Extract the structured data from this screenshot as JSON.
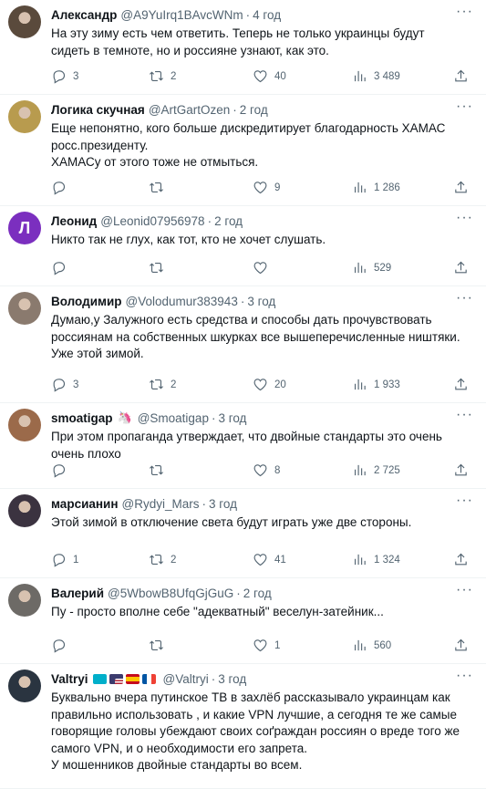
{
  "tweets": [
    {
      "name": "Александр",
      "handle": "@A9YuIrq1BAvcWNm",
      "time": "4 год",
      "text": "На эту зиму есть чем ответить. Теперь не только украинцы будут\nсидеть в темноте, но и россияне узнают, как это.",
      "replies": "3",
      "retweets": "2",
      "likes": "40",
      "views": "3 489",
      "avatar_color": "#5a4a3c",
      "avatar_letter": ""
    },
    {
      "name": "Логика скучная",
      "handle": "@ArtGartOzen",
      "time": "2 год",
      "text": "Еще непонятно, кого больше дискредитирует благодарность ХАМАС\nросс.президенту.\nХАМАСу от этого тоже не отмыться.",
      "replies": "",
      "retweets": "",
      "likes": "9",
      "views": "1 286",
      "avatar_color": "#b89b4e",
      "avatar_letter": ""
    },
    {
      "name": "Леонид",
      "handle": "@Leonid07956978",
      "time": "2 год",
      "text": "Никто так не глух, как тот, кто не хочет слушать.",
      "replies": "",
      "retweets": "",
      "likes": "",
      "views": "529",
      "avatar_color": "#7b2fbf",
      "avatar_letter": "Л"
    },
    {
      "name": "Володимир",
      "handle": "@Volodumur383943",
      "time": "3 год",
      "text": "Думаю,у Залужного есть средства и способы дать прочувствовать\nроссиянам на собственных шкурках все вышеперечисленные ништяки.\nУже этой зимой.",
      "replies": "3",
      "retweets": "2",
      "likes": "20",
      "views": "1 933",
      "avatar_color": "#8a7a6e",
      "avatar_letter": ""
    },
    {
      "name": "smoatigap",
      "handle": "@Smoatigap",
      "time": "3 год",
      "text": "При этом пропаганда утверждает, что двойные стандарты это очень\nочень плохо",
      "replies": "",
      "retweets": "",
      "likes": "8",
      "views": "2 725",
      "avatar_color": "#9b6a4a",
      "avatar_letter": "",
      "name_emoji": "🦄"
    },
    {
      "name": "марсианин",
      "handle": "@Rydyi_Mars",
      "time": "3 год",
      "text": "Этой зимой в отключение света будут играть уже две стороны.",
      "replies": "1",
      "retweets": "2",
      "likes": "41",
      "views": "1 324",
      "avatar_color": "#3b3340",
      "avatar_letter": ""
    },
    {
      "name": "Валерий",
      "handle": "@5WbowB8UfqGjGuG",
      "time": "2 год",
      "text": "Пу - просто вполне себе \"адекватный\" веселун-затейник...",
      "replies": "",
      "retweets": "",
      "likes": "1",
      "views": "560",
      "avatar_color": "#6d6a66",
      "avatar_letter": ""
    },
    {
      "name": "Valtryi",
      "handle": "@Valtryi",
      "time": "3 год",
      "text": "Буквально вчера путинское ТВ в захлёб рассказывало украинцам как\nправильно использовать , и какие VPN лучшие, а сегодня те же самые\nговорящие головы убеждают своих соґраждан россиян о вреде того же\nсамого VPN, и о необходимости его запрета.\nУ мошенников двойные стандарты во всем.",
      "replies": "",
      "retweets": "",
      "likes": "",
      "views": "",
      "avatar_color": "#2a3440",
      "avatar_letter": ""
    }
  ],
  "icons": {
    "reply": "reply-icon",
    "retweet": "retweet-icon",
    "like": "heart-icon",
    "views": "views-icon",
    "share": "share-icon",
    "more": "more-icon"
  },
  "flag_colors": {
    "kazakhstan": "#00afca",
    "usa": "#b22234",
    "spain": "#c60b1e",
    "france": "#0055a4"
  }
}
